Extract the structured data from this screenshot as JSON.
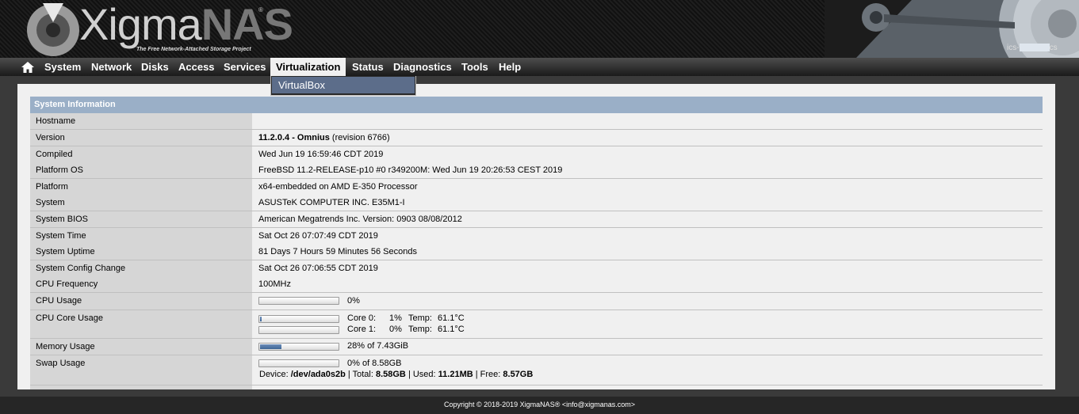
{
  "header": {
    "logo_xigma": "Xigma",
    "logo_nas": "NAS",
    "registered": "®",
    "tagline": "The Free Network-Attached Storage Project",
    "host_prefix": "ics-",
    "host_suffix": "cs"
  },
  "nav": {
    "items": [
      "System",
      "Network",
      "Disks",
      "Access",
      "Services",
      "Virtualization",
      "Status",
      "Diagnostics",
      "Tools",
      "Help"
    ],
    "active": "Virtualization",
    "dropdown": [
      "VirtualBox"
    ]
  },
  "section": {
    "title": "System Information"
  },
  "info": {
    "hostname": {
      "label": "Hostname",
      "value": ""
    },
    "version": {
      "label": "Version",
      "value_bold": "11.2.0.4 - Omnius",
      "value_rest": " (revision 6766)"
    },
    "compiled": {
      "label": "Compiled",
      "value": "Wed Jun 19 16:59:46 CDT 2019"
    },
    "platform_os": {
      "label": "Platform OS",
      "value": "FreeBSD 11.2-RELEASE-p10 #0 r349200M: Wed Jun 19 20:26:53 CEST 2019"
    },
    "platform": {
      "label": "Platform",
      "value": "x64-embedded on AMD E-350 Processor"
    },
    "system": {
      "label": "System",
      "value": "ASUSTeK COMPUTER INC. E35M1-I"
    },
    "system_bios": {
      "label": "System BIOS",
      "value": "American Megatrends Inc. Version: 0903 08/08/2012"
    },
    "system_time": {
      "label": "System Time",
      "value": "Sat Oct 26 07:07:49 CDT 2019"
    },
    "system_uptime": {
      "label": "System Uptime",
      "value": "81 Days 7 Hours 59 Minutes 56 Seconds"
    },
    "config_change": {
      "label": "System Config Change",
      "value": "Sat Oct 26 07:06:55 CDT 2019"
    },
    "cpu_frequency": {
      "label": "CPU Frequency",
      "value": "100MHz"
    },
    "cpu_usage": {
      "label": "CPU Usage",
      "value": "0%",
      "percent": 0
    },
    "cpu_core_usage": {
      "label": "CPU Core Usage",
      "cores": [
        {
          "name": "Core 0:",
          "usage": "1%",
          "temp_label": "Temp:",
          "temp": "61.1°C",
          "percent": 1
        },
        {
          "name": "Core 1:",
          "usage": "0%",
          "temp_label": "Temp:",
          "temp": "61.1°C",
          "percent": 0
        }
      ]
    },
    "memory_usage": {
      "label": "Memory Usage",
      "value": "28% of 7.43GiB",
      "percent": 28
    },
    "swap_usage": {
      "label": "Swap Usage",
      "value": "0% of 8.58GB",
      "percent": 0,
      "device_label": "Device: ",
      "device": "/dev/ada0s2b",
      "total_label": " | Total: ",
      "total": "8.58GB",
      "used_label": " | Used: ",
      "used": "11.21MB",
      "free_label": " | Free: ",
      "free": "8.57GB"
    }
  },
  "footer": {
    "copyright": "Copyright © 2018-2019 XigmaNAS® <info@xigmanas.com>"
  }
}
